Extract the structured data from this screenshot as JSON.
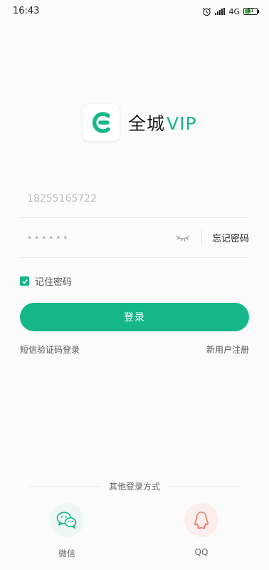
{
  "status_bar": {
    "time": "16:43",
    "network": "4G",
    "battery": "51",
    "battery_level": 0.51
  },
  "logo": {
    "name": "全城",
    "suffix": "VIP"
  },
  "login_form": {
    "phone_value": "18255165722",
    "password_mask": "••••••",
    "forgot_label": "忘记密码",
    "remember_label": "记住密码",
    "remember_checked": true,
    "login_label": "登录",
    "sms_login_label": "短信验证码登录",
    "register_label": "新用户注册"
  },
  "other_login": {
    "title": "其他登录方式",
    "wechat_label": "微信",
    "qq_label": "QQ"
  },
  "colors": {
    "accent": "#14b68a",
    "qq": "#f07a6a",
    "background": "#fbfbfb"
  }
}
